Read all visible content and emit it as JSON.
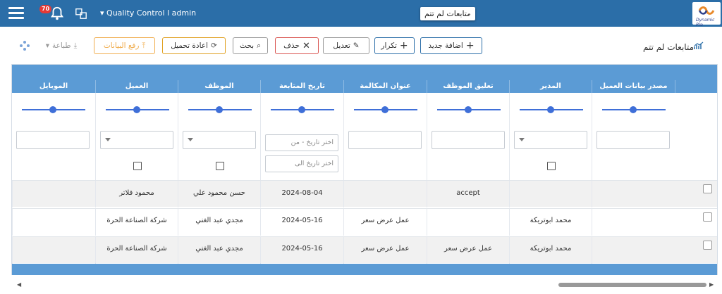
{
  "topbar": {
    "notification_count": "70",
    "user_label": "Quality Control l admin",
    "tab_title": "متابعات لم تتم",
    "tab_close": "X",
    "logo_text": "Dynamic Pro"
  },
  "toolbar": {
    "page_title": "متابعات لم تتم",
    "add_label": "اضافة جديد",
    "repeat_label": "تكرار",
    "edit_label": "تعديل",
    "delete_label": "حذف",
    "search_label": "بحث",
    "reload_label": "اعادة تحميل",
    "upload_label": "رفع البيانات",
    "print_label": "طباعة"
  },
  "columns": [
    "مصدر بيانات العميل",
    "المدير",
    "تعليق الموظف",
    "عنوان المكالمة",
    "تاريخ المتابعة",
    "الموظف",
    "العميل",
    "الموبايل"
  ],
  "filters": {
    "date_from_placeholder": "اختر تاريخ - من",
    "date_to_placeholder": "اختر تاريخ الى"
  },
  "rows": [
    {
      "source": "",
      "manager": "",
      "comment": "accept",
      "title": "",
      "date": "2024-08-04",
      "employee": "حسن محمود علي",
      "client": "محمود فلاتر",
      "mobile": ""
    },
    {
      "source": "",
      "manager": "محمد ابوتريكة",
      "comment": "",
      "title": "عمل عرض سعر",
      "date": "2024-05-16",
      "employee": "مجدي عبد الغني",
      "client": "شركة الصناعة الحرة",
      "mobile": ""
    },
    {
      "source": "",
      "manager": "محمد ابوتريكة",
      "comment": "عمل عرض سعر",
      "title": "عمل عرض سعر",
      "date": "2024-05-16",
      "employee": "مجدي عبد الغني",
      "client": "شركة الصناعة الحرة",
      "mobile": ""
    }
  ],
  "colors": {
    "header_blue": "#2b6ea8",
    "grid_blue": "#5b9bd5",
    "add_border": "#2b6ea8",
    "delete_border": "#d9534f",
    "reload_border": "#e0a020",
    "upload_border": "#f0ad4e"
  }
}
